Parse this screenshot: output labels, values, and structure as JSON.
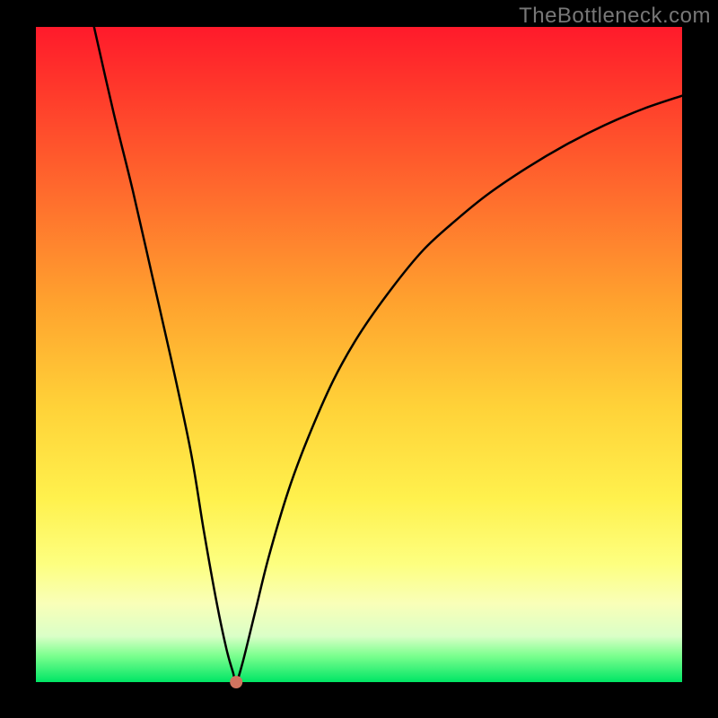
{
  "watermark": "TheBottleneck.com",
  "colors": {
    "background": "#000000",
    "gradient_top": "#ff1a2b",
    "gradient_bottom": "#00e565",
    "curve": "#000000",
    "marker": "#d1735f"
  },
  "chart_data": {
    "type": "line",
    "title": "",
    "xlabel": "",
    "ylabel": "",
    "xlim": [
      0,
      100
    ],
    "ylim": [
      0,
      100
    ],
    "series": [
      {
        "name": "curve",
        "x": [
          9,
          12,
          15,
          18,
          21,
          24,
          26,
          28,
          29.5,
          30.5,
          31,
          32,
          34,
          36,
          39,
          42,
          46,
          50,
          55,
          60,
          65,
          70,
          76,
          82,
          88,
          94,
          100
        ],
        "y": [
          100,
          87,
          75,
          62,
          49,
          35,
          23,
          12,
          5,
          1.5,
          0,
          3,
          11,
          19,
          29,
          37,
          46,
          53,
          60,
          66,
          70.5,
          74.5,
          78.5,
          82,
          85,
          87.5,
          89.5
        ]
      }
    ],
    "markers": [
      {
        "name": "optimum",
        "x": 31,
        "y": 0
      }
    ]
  }
}
